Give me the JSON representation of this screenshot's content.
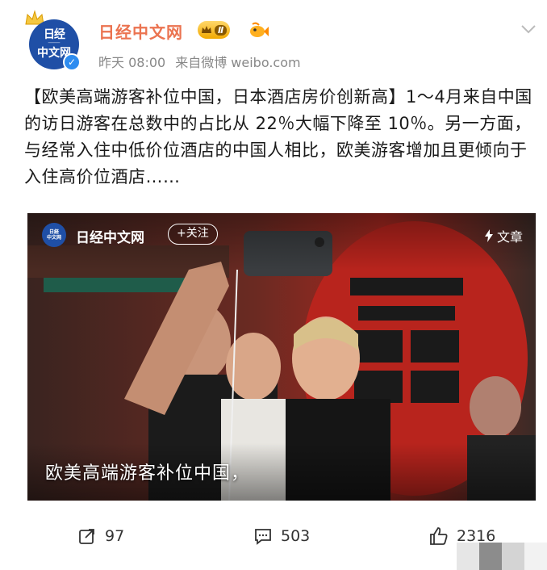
{
  "header": {
    "username": "日经中文网",
    "level_label": "Ⅱ",
    "timestamp": "昨天 08:00",
    "source": "来自微博 weibo.com",
    "avatar_text_top": "日经",
    "avatar_text_bottom": "中文网"
  },
  "post": {
    "topic": "【欧美高端游客补位中国，日本酒店房价创新高】",
    "body": "1～4月来自中国的访日游客在总数中的占比从 22％大幅下降至 10％。另一方面，与经常入住中低价位酒店的中国人相比，欧美游客增加且更倾向于入住高价位酒店……"
  },
  "media_card": {
    "account_name": "日经中文网",
    "follow_label": "+关注",
    "article_label": "文章",
    "caption": "欧美高端游客补位中国，"
  },
  "actions": {
    "reposts": "97",
    "comments": "503",
    "likes": "2316"
  },
  "colors": {
    "username": "#eb7350",
    "avatar_bg": "#1f4fa6",
    "verified": "#2d8cf0"
  }
}
